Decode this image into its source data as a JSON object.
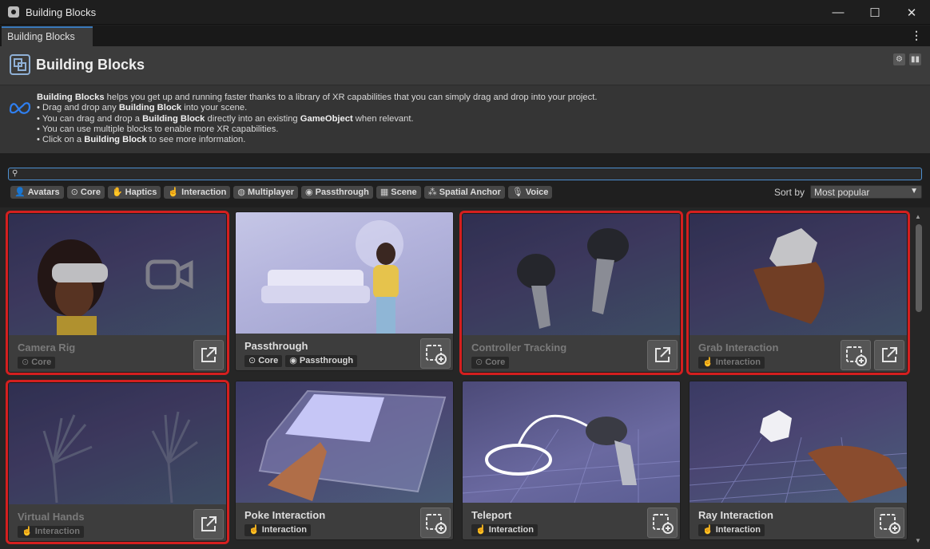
{
  "window": {
    "title": "Building Blocks",
    "controls": [
      "—",
      "☐",
      "✕"
    ]
  },
  "tab": {
    "label": "Building Blocks"
  },
  "header": {
    "title": "Building Blocks"
  },
  "description": {
    "intro_bold": "Building Blocks",
    "intro_rest": " helps you get up and running faster thanks to a library of XR capabilities that you can simply drag and drop into your project.",
    "b1_pre": "• Drag and drop any ",
    "b1_bold": "Building Block",
    "b1_post": " into your scene.",
    "b2_pre": "• You can drag and drop a ",
    "b2_bold1": "Building Block",
    "b2_mid": " directly into an existing ",
    "b2_bold2": "GameObject",
    "b2_post": " when relevant.",
    "b3": "• You can use multiple blocks to enable more XR capabilities.",
    "b4_pre": "• Click on a ",
    "b4_bold": "Building Block",
    "b4_post": " to see more information."
  },
  "search": {
    "value": "",
    "placeholder": ""
  },
  "filters": [
    {
      "label": "Avatars",
      "icon": "person-icon"
    },
    {
      "label": "Core",
      "icon": "headset-icon"
    },
    {
      "label": "Haptics",
      "icon": "hand-icon"
    },
    {
      "label": "Interaction",
      "icon": "pointer-hand-icon"
    },
    {
      "label": "Multiplayer",
      "icon": "globe-icon"
    },
    {
      "label": "Passthrough",
      "icon": "eye-icon"
    },
    {
      "label": "Scene",
      "icon": "grid-icon"
    },
    {
      "label": "Spatial Anchor",
      "icon": "anchor-nodes-icon"
    },
    {
      "label": "Voice",
      "icon": "microphone-icon"
    }
  ],
  "sort": {
    "label": "Sort by",
    "value": "Most popular"
  },
  "blocks": [
    {
      "name": "Camera Rig",
      "tags": [
        "Core"
      ],
      "selected": true,
      "buttons": [
        "open-docs"
      ]
    },
    {
      "name": "Passthrough",
      "tags": [
        "Core",
        "Passthrough"
      ],
      "selected": false,
      "buttons": [
        "add-block"
      ]
    },
    {
      "name": "Controller Tracking",
      "tags": [
        "Core"
      ],
      "selected": true,
      "buttons": [
        "open-docs"
      ]
    },
    {
      "name": "Grab Interaction",
      "tags": [
        "Interaction"
      ],
      "selected": true,
      "buttons": [
        "add-block",
        "open-docs"
      ]
    },
    {
      "name": "Virtual Hands",
      "tags": [
        "Interaction"
      ],
      "selected": true,
      "buttons": [
        "open-docs"
      ]
    },
    {
      "name": "Poke Interaction",
      "tags": [
        "Interaction"
      ],
      "selected": false,
      "buttons": [
        "add-block"
      ]
    },
    {
      "name": "Teleport",
      "tags": [
        "Interaction"
      ],
      "selected": false,
      "buttons": [
        "add-block"
      ]
    },
    {
      "name": "Ray Interaction",
      "tags": [
        "Interaction"
      ],
      "selected": false,
      "buttons": [
        "add-block"
      ]
    }
  ],
  "colors": {
    "selection_outline": "#d41f1f",
    "accent": "#4d8fd1",
    "meta_blue": "#2f7ff0"
  }
}
